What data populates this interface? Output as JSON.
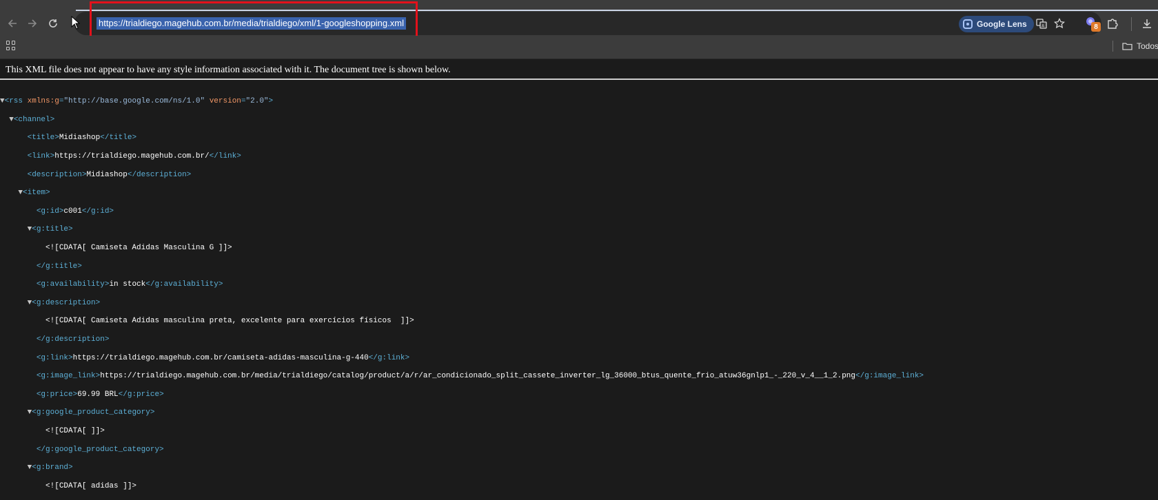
{
  "browser": {
    "url": "https://trialdiego.magehub.com.br/media/trialdiego/xml/1-googleshopping.xml",
    "google_lens_label": "Google Lens",
    "extension_badge": "8",
    "bookmarks_folder": "Todos"
  },
  "page": {
    "banner": "This XML file does not appear to have any style information associated with it. The document tree is shown below."
  },
  "xml": {
    "rss_attr1_name": "xmlns:g",
    "rss_attr1_value": "\"http://base.google.com/ns/1.0\"",
    "rss_attr2_name": "version",
    "rss_attr2_value": "\"2.0\"",
    "channel_title": "Midiashop",
    "channel_link": "https://trialdiego.magehub.com.br/",
    "channel_description": "Midiashop",
    "item": {
      "id": "c001",
      "title_cdata": "<![CDATA[ Camiseta Adidas Masculina G ]]>",
      "availability": "in stock",
      "description_cdata": "<![CDATA[ Camiseta Adidas masculina preta, excelente para exercícios físicos  ]]>",
      "link": "https://trialdiego.magehub.com.br/camiseta-adidas-masculina-g-440",
      "image_link": "https://trialdiego.magehub.com.br/media/trialdiego/catalog/product/a/r/ar_condicionado_split_cassete_inverter_lg_36000_btus_quente_frio_atuw36gnlp1_-_220_v_4__1_2.png",
      "price": "69.99 BRL",
      "google_product_category_cdata": "<![CDATA[ ]]>",
      "brand_cdata": "<![CDATA[ adidas ]]>"
    }
  },
  "tags": {
    "rss_open": "<rss",
    "rss_close": ">",
    "channel_open": "<channel>",
    "title_open": "<title>",
    "title_close": "</title>",
    "link_open": "<link>",
    "link_close": "</link>",
    "description_open": "<description>",
    "description_close": "</description>",
    "item_open": "<item>",
    "gid_open": "<g:id>",
    "gid_close": "</g:id>",
    "gtitle_open": "<g:title>",
    "gtitle_close": "</g:title>",
    "gavail_open": "<g:availability>",
    "gavail_close": "</g:availability>",
    "gdesc_open": "<g:description>",
    "gdesc_close": "</g:description>",
    "glink_open": "<g:link>",
    "glink_close": "</g:link>",
    "gimg_open": "<g:image_link>",
    "gimg_close": "</g:image_link>",
    "gprice_open": "<g:price>",
    "gprice_close": "</g:price>",
    "gcat_open": "<g:google_product_category>",
    "gcat_close": "</g:google_product_category>",
    "gbrand_open": "<g:brand>"
  },
  "icons": [
    "back-icon",
    "forward-icon",
    "reload-icon",
    "google-lens-icon",
    "translate-icon",
    "star-icon",
    "extension-icon",
    "puzzle-icon",
    "download-icon",
    "apps-icon",
    "folder-icon"
  ]
}
